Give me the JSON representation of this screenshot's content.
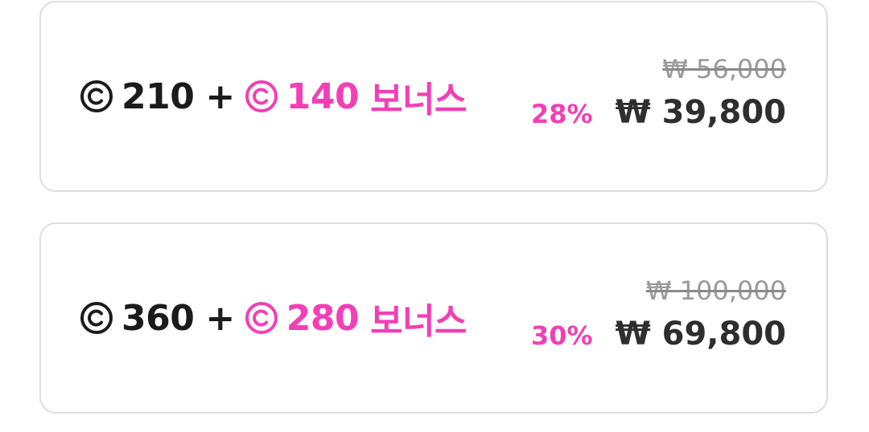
{
  "colors": {
    "accent": "#f23fb6",
    "text": "#1b1b1b",
    "strike": "#9a9a9a",
    "border": "#dedede"
  },
  "icons": {
    "coin": "circled-c-coin-icon"
  },
  "packages": [
    {
      "base_amount": "210",
      "plus": "+",
      "bonus_amount": "140",
      "bonus_label": "보너스",
      "original_price": "₩ 56,000",
      "discount": "28%",
      "sale_price": "₩ 39,800"
    },
    {
      "base_amount": "360",
      "plus": "+",
      "bonus_amount": "280",
      "bonus_label": "보너스",
      "original_price": "₩ 100,000",
      "discount": "30%",
      "sale_price": "₩ 69,800"
    }
  ]
}
